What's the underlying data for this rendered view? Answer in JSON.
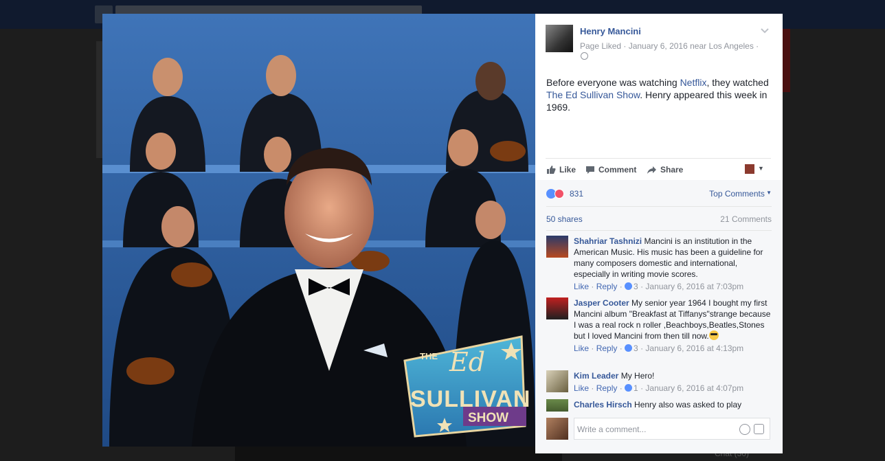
{
  "post": {
    "author": "Henry Mancini",
    "meta": "Page Liked · January 6, 2016 near Los Angeles ·",
    "text_before": "Before everyone was watching ",
    "link1": "Netflix",
    "text_mid": ", they watched ",
    "link2": "The Ed Sullivan Show",
    "text_after": ". Henry appeared this week in 1969."
  },
  "actions": {
    "like": "Like",
    "comment": "Comment",
    "share": "Share"
  },
  "stats": {
    "reactions": "831",
    "top_comments": "Top Comments",
    "shares": "50 shares",
    "comments": "21 Comments"
  },
  "comments": [
    {
      "name": "Shahriar Tashnizi",
      "text": "Mancini is an institution in the American Music. His music has been a guideline for many composers domestic and international, especially in writing movie scores.",
      "like": "Like",
      "reply": "Reply",
      "likes": "3",
      "time": "January 6, 2016 at 7:03pm"
    },
    {
      "name": "Jasper Cooter",
      "text": "My senior year 1964 I bought my first Mancini album \"Breakfast at Tiffanys\"strange because I was a real rock n roller ,Beachboys,Beatles,Stones but I loved Mancini from then till now.",
      "like": "Like",
      "reply": "Reply",
      "likes": "3",
      "time": "January 6, 2016 at 4:13pm"
    },
    {
      "name": "Kim Leader",
      "text": "My Hero!",
      "like": "Like",
      "reply": "Reply",
      "likes": "1",
      "time": "January 6, 2016 at 4:07pm"
    },
    {
      "name": "Charles Hirsch",
      "text": "Henry also was asked to play"
    }
  ],
  "comment_box": {
    "placeholder": "Write a comment..."
  },
  "logo": {
    "line1": "THE",
    "line2": "Ed",
    "line3": "SULLIVAN",
    "line4": "SHOW"
  },
  "background": {
    "chat": "Chat (30)"
  }
}
